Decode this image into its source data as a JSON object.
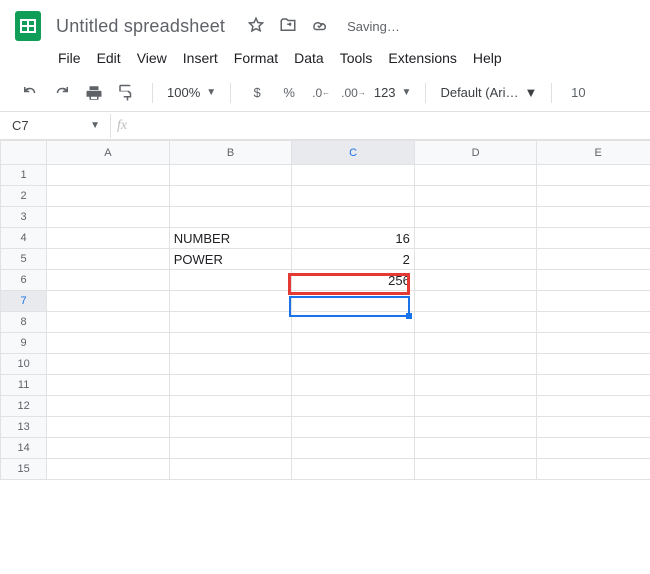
{
  "title": "Untitled spreadsheet",
  "saving": "Saving…",
  "menu": {
    "file": "File",
    "edit": "Edit",
    "view": "View",
    "insert": "Insert",
    "format": "Format",
    "data": "Data",
    "tools": "Tools",
    "extensions": "Extensions",
    "help": "Help"
  },
  "toolbar": {
    "zoom": "100%",
    "currency": "$",
    "percent": "%",
    "dec_dec": ".0",
    "inc_dec": ".00",
    "num_format": "123",
    "font": "Default (Ari…",
    "font_size": "10"
  },
  "namebox": "C7",
  "fx_label": "fx",
  "formula": "",
  "columns": [
    "A",
    "B",
    "C",
    "D",
    "E"
  ],
  "rows": [
    "1",
    "2",
    "3",
    "4",
    "5",
    "6",
    "7",
    "8",
    "9",
    "10",
    "11",
    "12",
    "13",
    "14",
    "15"
  ],
  "cells": {
    "B4": "NUMBER",
    "B5": "POWER",
    "C4": "16",
    "C5": "2",
    "C6": "256"
  },
  "selected_cell": "C7",
  "highlight_cell": "C6"
}
